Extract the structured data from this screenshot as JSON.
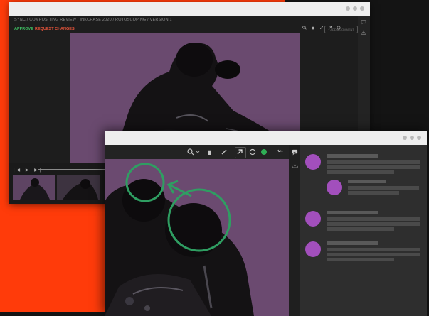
{
  "back_window": {
    "breadcrumb": "SYNC / COMPOSITING REVIEW / INKCHASE 2020 / ROTOSCOPING / VERSION 1",
    "approve_label": "APPROVE",
    "request_changes_label": "REQUEST CHANGES",
    "add_comment_label": "+ ADD A COMMENT",
    "transport_label": "|◀ ▶ ▶|"
  },
  "front_window": {
    "tools": [
      "zoom-icon",
      "chevron-down-icon",
      "hand-icon",
      "pen-icon",
      "arrow-icon",
      "circle-icon",
      "color-dot-icon",
      "undo-icon"
    ],
    "annotation_color": "#2f9e62",
    "selected_color": "#2fae55"
  },
  "colors": {
    "brand_orange": "#ff3b0a",
    "approve_green": "#3fbf62",
    "request_red": "#e8543a",
    "avatar_purple": "#a24fbc"
  },
  "comments": [
    {
      "id": 1,
      "indent": false
    },
    {
      "id": 2,
      "indent": true
    },
    {
      "id": 3,
      "indent": false
    },
    {
      "id": 4,
      "indent": false
    }
  ]
}
